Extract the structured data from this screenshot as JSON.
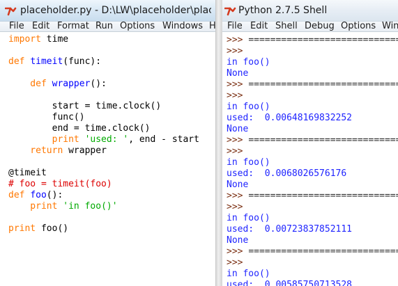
{
  "left_window": {
    "title": "placeholder.py - D:\\LW\\placeholder\\placeholder",
    "menu": [
      "File",
      "Edit",
      "Format",
      "Run",
      "Options",
      "Windows",
      "H"
    ],
    "code_lines": [
      [
        {
          "text": "import",
          "cls": "kw"
        },
        {
          "text": " time",
          "cls": "txt"
        }
      ],
      [],
      [
        {
          "text": "def",
          "cls": "kw"
        },
        {
          "text": " ",
          "cls": "txt"
        },
        {
          "text": "timeit",
          "cls": "fn"
        },
        {
          "text": "(func):",
          "cls": "txt"
        }
      ],
      [],
      [
        {
          "text": "    def",
          "cls": "kw"
        },
        {
          "text": " ",
          "cls": "txt"
        },
        {
          "text": "wrapper",
          "cls": "fn"
        },
        {
          "text": "():",
          "cls": "txt"
        }
      ],
      [],
      [
        {
          "text": "        start = time.clock()",
          "cls": "txt"
        }
      ],
      [
        {
          "text": "        func()",
          "cls": "txt"
        }
      ],
      [
        {
          "text": "        end = time.clock()",
          "cls": "txt"
        }
      ],
      [
        {
          "text": "        print",
          "cls": "kw"
        },
        {
          "text": " ",
          "cls": "txt"
        },
        {
          "text": "'used: '",
          "cls": "str"
        },
        {
          "text": ", end - start",
          "cls": "txt"
        }
      ],
      [
        {
          "text": "    return",
          "cls": "kw"
        },
        {
          "text": " wrapper",
          "cls": "txt"
        }
      ],
      [],
      [
        {
          "text": "@timeit",
          "cls": "txt"
        }
      ],
      [
        {
          "text": "# foo = timeit(foo)",
          "cls": "cmt"
        }
      ],
      [
        {
          "text": "def",
          "cls": "kw"
        },
        {
          "text": " ",
          "cls": "txt"
        },
        {
          "text": "foo",
          "cls": "fn"
        },
        {
          "text": "():",
          "cls": "txt"
        }
      ],
      [
        {
          "text": "    print",
          "cls": "kw"
        },
        {
          "text": " ",
          "cls": "txt"
        },
        {
          "text": "'in foo()'",
          "cls": "str"
        }
      ],
      [],
      [
        {
          "text": "print",
          "cls": "kw"
        },
        {
          "text": " foo()",
          "cls": "txt"
        }
      ]
    ]
  },
  "right_window": {
    "title": "Python 2.7.5 Shell",
    "menu": [
      "File",
      "Edit",
      "Shell",
      "Debug",
      "Options",
      "Wind"
    ],
    "shell_lines": [
      [
        {
          "text": ">>> ",
          "cls": "prompt"
        },
        {
          "text": "================================",
          "cls": "eq"
        }
      ],
      [
        {
          "text": ">>>",
          "cls": "prompt"
        }
      ],
      [
        {
          "text": "in foo()",
          "cls": "out"
        }
      ],
      [
        {
          "text": "None",
          "cls": "out"
        }
      ],
      [
        {
          "text": ">>> ",
          "cls": "prompt"
        },
        {
          "text": "================================",
          "cls": "eq"
        }
      ],
      [
        {
          "text": ">>>",
          "cls": "prompt"
        }
      ],
      [
        {
          "text": "in foo()",
          "cls": "out"
        }
      ],
      [
        {
          "text": "used:  0.00648169832252",
          "cls": "out"
        }
      ],
      [
        {
          "text": "None",
          "cls": "out"
        }
      ],
      [
        {
          "text": ">>> ",
          "cls": "prompt"
        },
        {
          "text": "================================",
          "cls": "eq"
        }
      ],
      [
        {
          "text": ">>>",
          "cls": "prompt"
        }
      ],
      [
        {
          "text": "in foo()",
          "cls": "out"
        }
      ],
      [
        {
          "text": "used:  0.0068026576176",
          "cls": "out"
        }
      ],
      [
        {
          "text": "None",
          "cls": "out"
        }
      ],
      [
        {
          "text": ">>> ",
          "cls": "prompt"
        },
        {
          "text": "================================",
          "cls": "eq"
        }
      ],
      [
        {
          "text": ">>>",
          "cls": "prompt"
        }
      ],
      [
        {
          "text": "in foo()",
          "cls": "out"
        }
      ],
      [
        {
          "text": "used:  0.00723837852111",
          "cls": "out"
        }
      ],
      [
        {
          "text": "None",
          "cls": "out"
        }
      ],
      [
        {
          "text": ">>> ",
          "cls": "prompt"
        },
        {
          "text": "================================",
          "cls": "eq"
        }
      ],
      [
        {
          "text": ">>>",
          "cls": "prompt"
        }
      ],
      [
        {
          "text": "in foo()",
          "cls": "out"
        }
      ],
      [
        {
          "text": "used:  0.00585750713528",
          "cls": "out"
        }
      ]
    ]
  },
  "colors": {
    "keyword": "#ff7700",
    "definition": "#0000ff",
    "string": "#00aa00",
    "comment": "#dd0000",
    "shell_output": "#1f24ff",
    "shell_prompt": "#7b2f12"
  },
  "icons": {
    "app": "python-idle-icon"
  }
}
